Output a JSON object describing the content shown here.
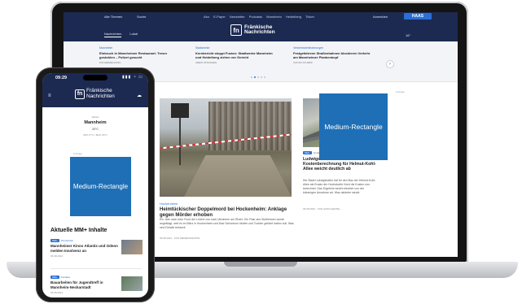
{
  "laptop": {
    "header": {
      "menu_label": "Alle Themen",
      "search_label": "Suche",
      "nav_items": [
        "Abo",
        "E-Paper",
        "Newsletter",
        "Podcasts",
        "Mannheim",
        "Heidelberg",
        "Ticket"
      ],
      "login_label": "Anmelden",
      "haas_label": "HAAS",
      "tabs": [
        "Nachrichten",
        "Lokal"
      ],
      "brand_letters": "fn",
      "brand_line1": "Fränkische",
      "brand_line2": "Nachrichten",
      "weather": "16°"
    },
    "ticker": [
      {
        "tag": "Mannheim",
        "headline": "Einbruch in Mannheimer Restaurant: Treser gestohlen – Polizei gesucht",
        "meta": "POLIZEIMELDUNG"
      },
      {
        "tag": "Stadtwerke",
        "headline": "Kernbericht stoppt Fusion: Stadtwerke Mannheim und Heidelberg ziehen vor Gericht",
        "meta": "KREIS STRASSEN"
      },
      {
        "tag": "Verkehrsbehinderungen",
        "headline": "Festgefahrene Straßenbahnen blockieren Verkehr am Mannheimer Plankenkopf",
        "meta": "VON BJ STUMPF"
      }
    ],
    "ticker_next": "›",
    "main_story": {
      "pre": "Hockenheim",
      "headline": "Heimtückischer Doppelmord bei Hockenheim: Anklage gegen Mörder erhoben",
      "lead": "Ein Jahr nach dem Fund der Leiche von zwei Ukrainern am Rhein: Ein Paar aus Südhessen wurde angeklagt, weil es im März in Hockenheim und Bad Schönborn Mutter und Tochter getötet haben soll. Was sind Details bekannt",
      "meta": "05.08.2024 · VON MEDIENGRUPPE"
    },
    "side_story": {
      "badge": "MM+",
      "category": "Großprojekte",
      "headline": "Ludwigshafen: Neue Kostenberechnung für Helmut-Kohl-Allee weicht deutlich ab",
      "lead": "Die Stadt Ludwigshafen hat für den Bau der Helmut-Kohl-Allee als Ersatz der Hochstraße Nord die Kosten neu berechnet. Das Ergebnis weicht deutlich von der bisherigen Annahme ab. Was dahinter steckt",
      "meta": "05.08.2024 · VON HANS HERTEL"
    },
    "ad_label": "Anzeige",
    "medium_rectangle": "Medium-Rectangle"
  },
  "phone": {
    "time": "09:29",
    "signal": "▮▮▮ ◔ ▭",
    "menu_icon": "≡",
    "brand_letters": "fn",
    "brand_line1": "Fränkische",
    "brand_line2": "Nachrichten",
    "location": {
      "small": "Wetter",
      "city": "Mannheim",
      "temp": "20°C",
      "range": "MIN 17°C | MAX 26°C"
    },
    "ad_label": "Anzeige",
    "medium_rectangle": "Medium-Rectangle",
    "section_title": "Aktuelle MM+ Inhalte",
    "items": [
      {
        "badge": "MM+",
        "category": "Kinobetrieb",
        "title": "Mannheimer Kinos Atlantis und Odeon melden Insolvenz an",
        "date": "05.08.2024"
      },
      {
        "badge": "MM+",
        "category": "Soziales",
        "title": "Bauarbeiten für Jugendtreff in Mannheim-Neckarstadt",
        "date": "05.08.2024"
      }
    ]
  }
}
